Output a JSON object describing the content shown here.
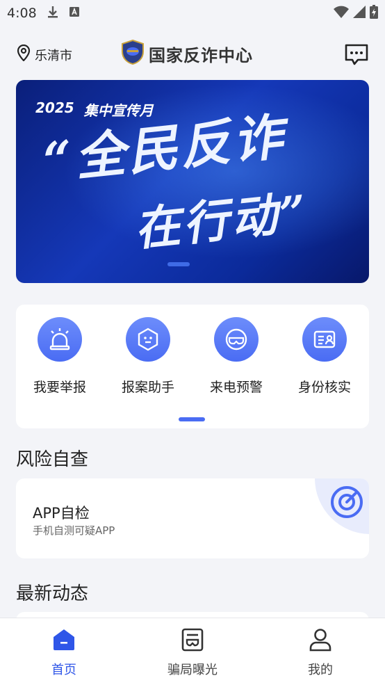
{
  "status_bar": {
    "time": "4:08",
    "icons": [
      "download-icon",
      "a-badge-icon",
      "wifi-icon",
      "signal-icon",
      "battery-icon"
    ]
  },
  "header": {
    "location": "乐清市",
    "title": "国家反诈中心",
    "icons": [
      "location-pin-icon",
      "logo-emblem",
      "message-icon"
    ]
  },
  "banner": {
    "year": "2025",
    "subtitle": "集中宣传月",
    "line1": "“全民反诈",
    "line2": "在行动”",
    "colors": {
      "bg_dark": "#08186a",
      "bg_mid": "#1538b8"
    }
  },
  "quick_actions": [
    {
      "label": "我要举报",
      "icon": "alarm-light-icon"
    },
    {
      "label": "报案助手",
      "icon": "hexagon-robot-icon"
    },
    {
      "label": "来电预警",
      "icon": "phone-mask-icon"
    },
    {
      "label": "身份核实",
      "icon": "id-card-icon"
    }
  ],
  "risk_section": {
    "title": "风险自查",
    "app_check": {
      "title": "APP自检",
      "subtitle": "手机自测可疑APP",
      "icon": "radar-scan-icon"
    }
  },
  "news_section": {
    "title": "最新动态"
  },
  "tab_bar": {
    "tabs": [
      {
        "label": "首页",
        "icon": "home-icon",
        "active": true
      },
      {
        "label": "骗局曝光",
        "icon": "exposure-doc-icon",
        "active": false
      },
      {
        "label": "我的",
        "icon": "user-icon",
        "active": false
      }
    ]
  },
  "colors": {
    "accent": "#4a6cf3",
    "tab_active": "#2f56e8",
    "page_bg": "#f3f4f8"
  }
}
